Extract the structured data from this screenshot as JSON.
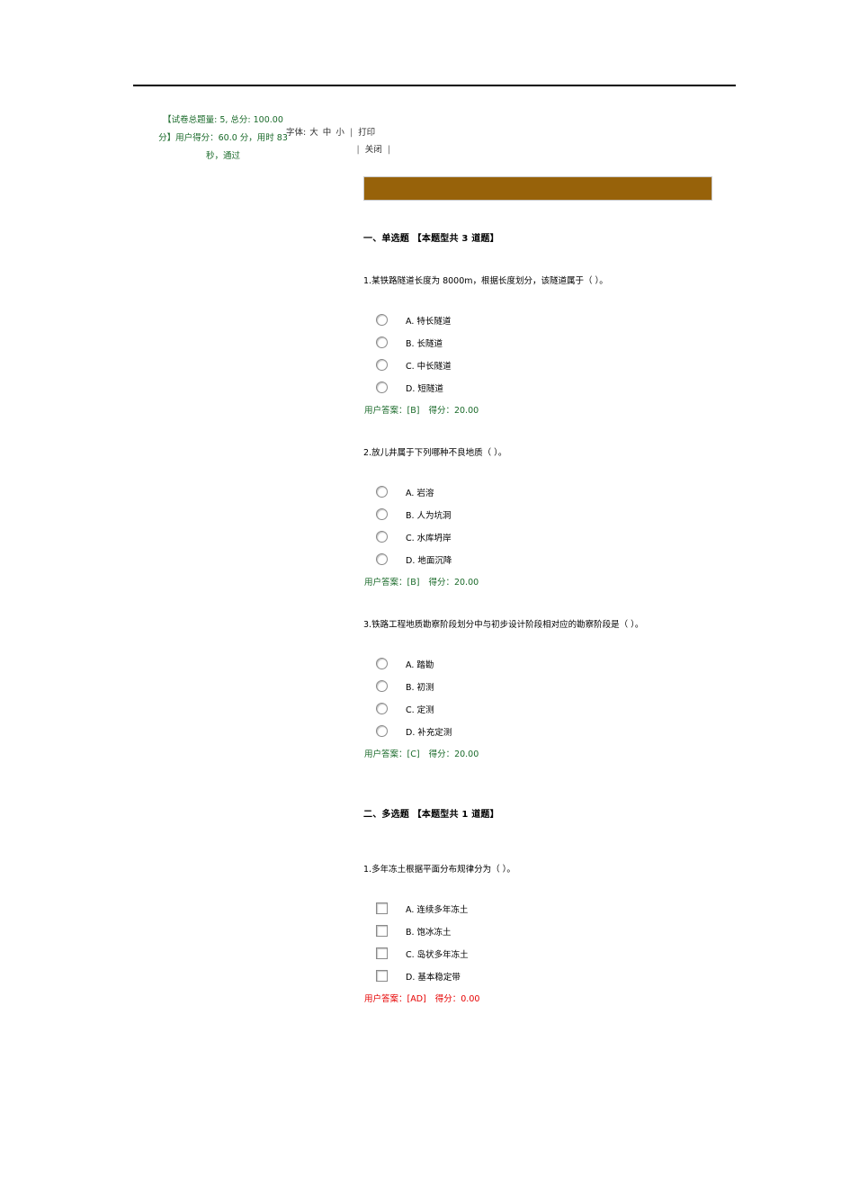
{
  "header": {
    "exam_meta_line1": "【试卷总题量: 5, 总分: 100.00",
    "exam_meta_line2": "分】用户得分：60.0 分，用时 83",
    "exam_meta_line3": "秒，通过",
    "font_label": "字体:",
    "font_large": "大",
    "font_medium": "中",
    "font_small": "小",
    "separator": "|",
    "print_label": "打印",
    "close_label": "关闭"
  },
  "banner": {
    "color": "#97620a",
    "text": ""
  },
  "sections": [
    {
      "title": "一、单选题 【本题型共 3 道题】",
      "type": "single",
      "questions": [
        {
          "stem": "1.某铁路隧道长度为 8000m，根据长度划分，该隧道属于（  ）。",
          "options": [
            "A.  特长隧道",
            "B.  长隧道",
            "C.  中长隧道",
            "D.  短隧道"
          ],
          "answer_prefix": "用户答案：",
          "answer_value": "[B]",
          "score_prefix": "得分：",
          "score_value": "20.00",
          "correct": true
        },
        {
          "stem": "2.放儿井属于下列哪种不良地质（  ）。",
          "options": [
            "A.  岩溶",
            "B.  人为坑洞",
            "C.  水库坍岸",
            "D.  地面沉降"
          ],
          "answer_prefix": "用户答案：",
          "answer_value": "[B]",
          "score_prefix": "得分：",
          "score_value": "20.00",
          "correct": true
        },
        {
          "stem": "3.铁路工程地质勘察阶段划分中与初步设计阶段相对应的勘察阶段是（  ）。",
          "options": [
            "A.  踏勘",
            "B.  初测",
            "C.  定测",
            "D.  补充定测"
          ],
          "answer_prefix": "用户答案：",
          "answer_value": "[C]",
          "score_prefix": "得分：",
          "score_value": "20.00",
          "correct": true
        }
      ]
    },
    {
      "title": "二、多选题 【本题型共 1 道题】",
      "type": "multi",
      "questions": [
        {
          "stem": "1.多年冻土根据平面分布规律分为（  ）。",
          "options": [
            "A.  连续多年冻土",
            "B.  饱冰冻土",
            "C.  岛状多年冻土",
            "D.  基本稳定带"
          ],
          "answer_prefix": "用户答案：",
          "answer_value": "[AD]",
          "score_prefix": "得分：",
          "score_value": "0.00",
          "correct": false
        }
      ]
    }
  ]
}
